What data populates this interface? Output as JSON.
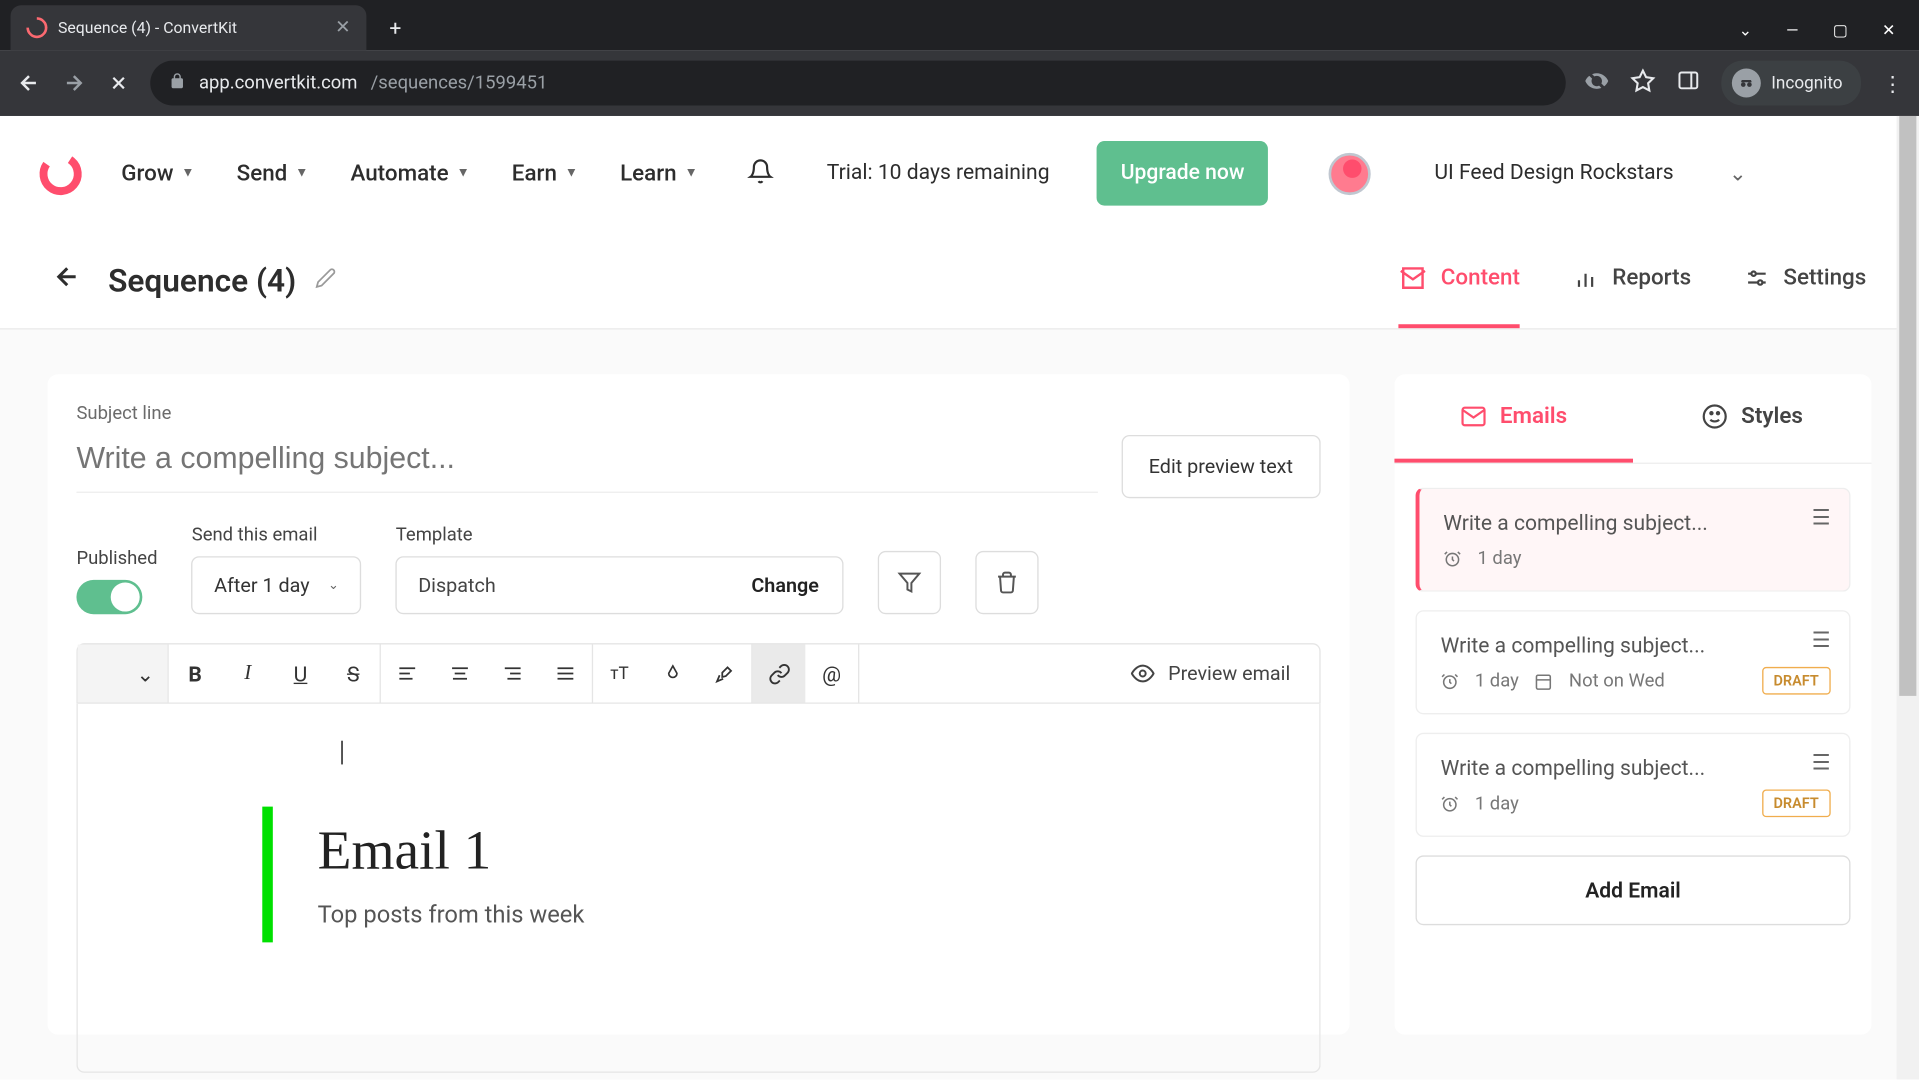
{
  "browser": {
    "tab_title": "Sequence (4) - ConvertKit",
    "url_host": "app.convertkit.com",
    "url_path": "/sequences/1599451",
    "incognito": "Incognito"
  },
  "nav": {
    "items": [
      "Grow",
      "Send",
      "Automate",
      "Earn",
      "Learn"
    ],
    "trial": "Trial: 10 days remaining",
    "upgrade": "Upgrade now",
    "account": "UI Feed Design Rockstars"
  },
  "subheader": {
    "title": "Sequence (4)",
    "tabs": [
      "Content",
      "Reports",
      "Settings"
    ]
  },
  "editor": {
    "subject_label": "Subject line",
    "subject_placeholder": "Write a compelling subject...",
    "edit_preview": "Edit preview text",
    "published_label": "Published",
    "send_label": "Send this email",
    "send_value": "After 1 day",
    "template_label": "Template",
    "template_value": "Dispatch",
    "change": "Change",
    "preview": "Preview email",
    "body_title": "Email 1",
    "body_subtitle": "Top posts from this week"
  },
  "side": {
    "tab_emails": "Emails",
    "tab_styles": "Styles",
    "cards": [
      {
        "title": "Write a compelling subject...",
        "delay": "1 day",
        "extra": "",
        "draft": false
      },
      {
        "title": "Write a compelling subject...",
        "delay": "1 day",
        "extra": "Not on Wed",
        "draft": true
      },
      {
        "title": "Write a compelling subject...",
        "delay": "1 day",
        "extra": "",
        "draft": true
      }
    ],
    "draft_label": "DRAFT",
    "add": "Add Email"
  }
}
